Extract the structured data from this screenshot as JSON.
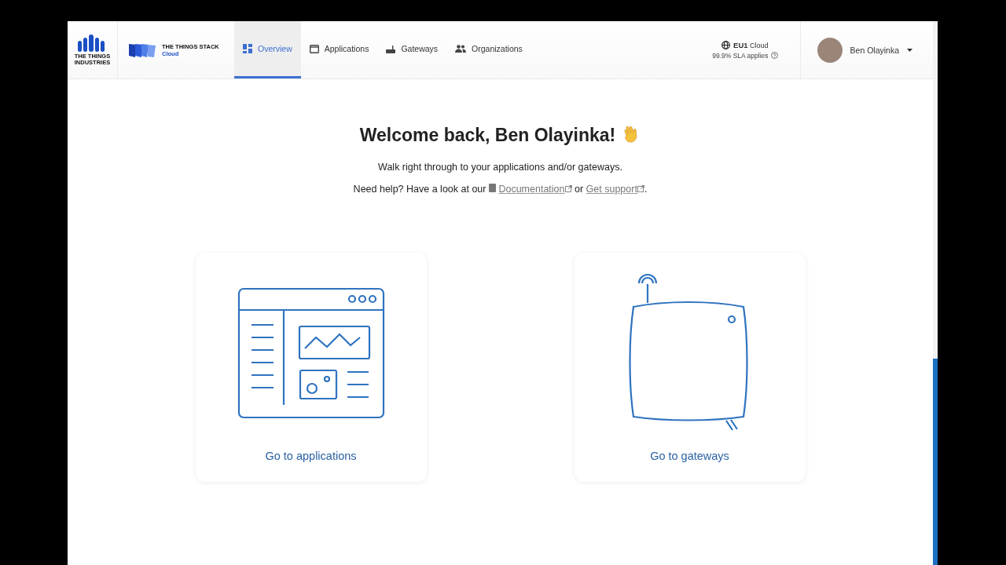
{
  "header": {
    "logo_text": "THE THINGS INDUSTRIES",
    "product": {
      "name": "THE THINGS STACK",
      "edition": "Cloud"
    },
    "nav": [
      {
        "label": "Overview",
        "kind": "overview",
        "selected": true
      },
      {
        "label": "Applications",
        "kind": "applications",
        "selected": false
      },
      {
        "label": "Gateways",
        "kind": "gateways",
        "selected": false
      },
      {
        "label": "Organizations",
        "kind": "organizations",
        "selected": false
      }
    ],
    "cluster": {
      "region": "EU1",
      "name": "Cloud",
      "sla": "99.9% SLA applies"
    },
    "user": {
      "name": "Ben Olayinka"
    }
  },
  "welcome": {
    "title": "Welcome back, Ben Olayinka!",
    "subtitle": "Walk right through to your applications and/or gateways.",
    "help": {
      "before": "Need help? Have a look at our",
      "links": [
        {
          "label": "Documentation",
          "kind": "docs"
        },
        {
          "label": "Get support",
          "kind": "support"
        }
      ],
      "between": "or",
      "after": "."
    }
  },
  "cards": [
    {
      "kind": "applications",
      "label": "Go to applications"
    },
    {
      "kind": "gateways",
      "label": "Go to gateways"
    }
  ]
}
